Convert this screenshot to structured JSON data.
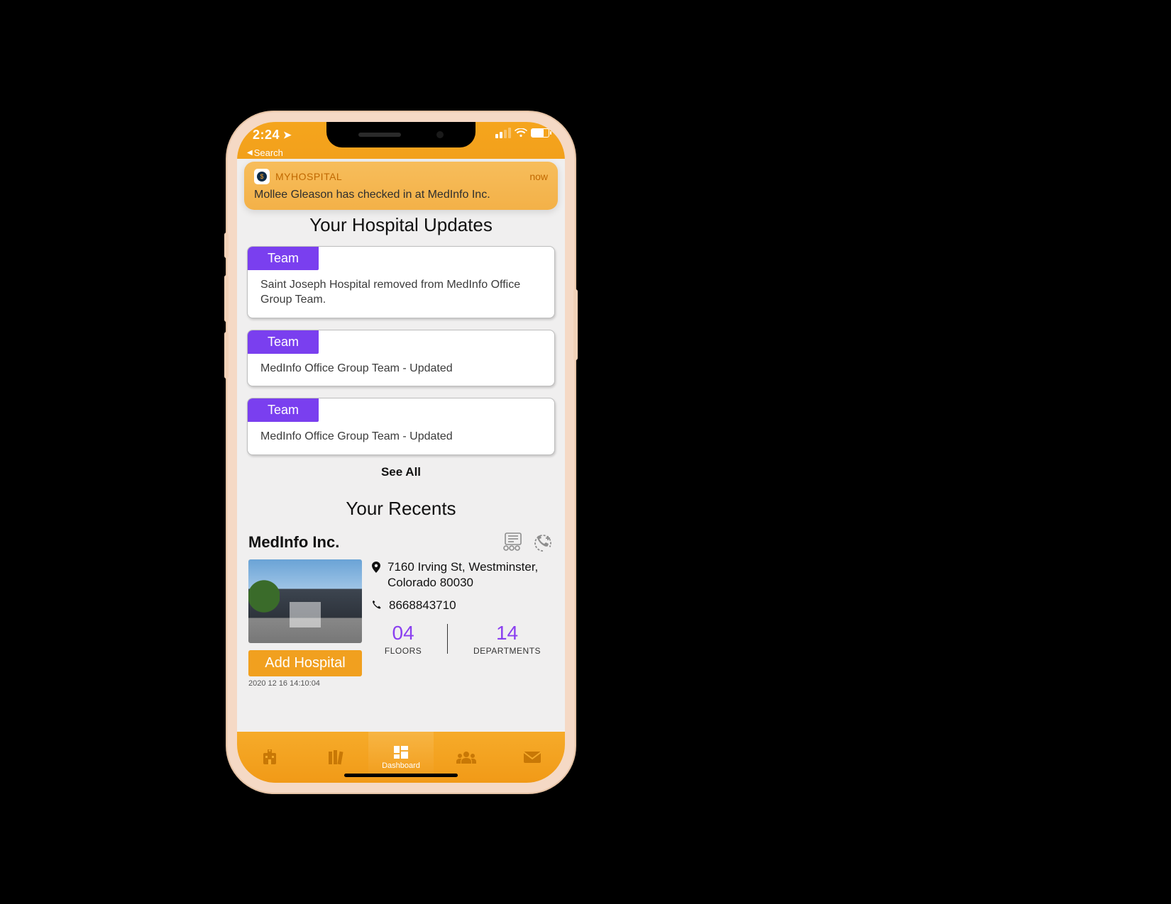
{
  "statusbar": {
    "time": "2:24",
    "back_label": "Search"
  },
  "notification": {
    "app_name": "MYHOSPITAL",
    "when": "now",
    "body": "Mollee Gleason has checked in at MedInfo Inc."
  },
  "updates": {
    "title": "Your Hospital Updates",
    "items": [
      {
        "tag": "Team",
        "text": "Saint Joseph Hospital removed from MedInfo Office Group Team."
      },
      {
        "tag": "Team",
        "text": "MedInfo Office Group Team - Updated"
      },
      {
        "tag": "Team",
        "text": "MedInfo Office Group Team - Updated"
      }
    ],
    "see_all": "See All"
  },
  "recents": {
    "title": "Your Recents",
    "name": "MedInfo Inc.",
    "address": "7160 Irving St, Westminster, Colorado 80030",
    "phone": "8668843710",
    "floors_value": "04",
    "floors_label": "FLOORS",
    "departments_value": "14",
    "departments_label": "DEPARTMENTS",
    "add_button": "Add Hospital",
    "timestamp_peek": "2020 12 16 14:10:04"
  },
  "tabbar": {
    "active_label": "Dashboard"
  }
}
